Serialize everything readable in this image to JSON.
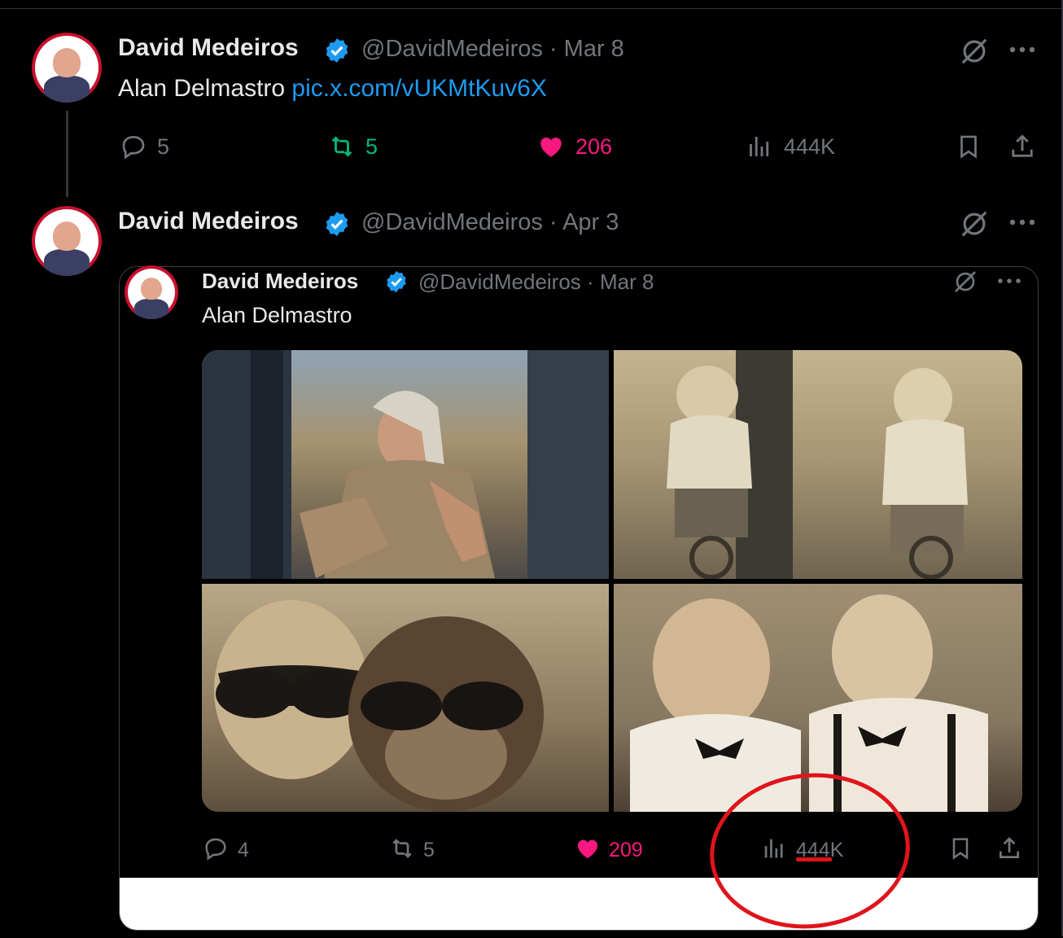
{
  "colors": {
    "accent_link": "#1d9bf0",
    "retweet_green": "#00ba7c",
    "like_pink": "#f91880",
    "muted": "#71767b",
    "annotation_red": "#e0141b"
  },
  "tweet1": {
    "name": "David Medeiros",
    "handle": "@DavidMedeiros",
    "date": "Mar 8",
    "text": "Alan Delmastro",
    "link": "pic.x.com/vUKMtKuv6X",
    "replies": "5",
    "retweets": "5",
    "likes": "206",
    "views": "444K"
  },
  "tweet2": {
    "name": "David Medeiros",
    "handle": "@DavidMedeiros",
    "date": "Apr 3"
  },
  "quoted": {
    "name": "David Medeiros",
    "handle": "@DavidMedeiros",
    "date": "Mar 8",
    "text": "Alan Delmastro",
    "replies": "4",
    "retweets": "5",
    "likes": "209",
    "views": "444K"
  },
  "separator": "·",
  "icons": [
    "verified-badge-icon",
    "grok-icon",
    "more-icon",
    "reply-icon",
    "retweet-icon",
    "like-icon",
    "views-icon",
    "bookmark-icon",
    "share-icon"
  ]
}
